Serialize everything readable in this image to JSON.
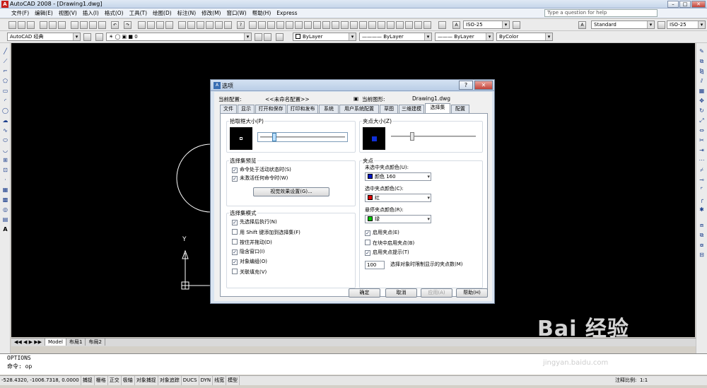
{
  "window": {
    "title": "AutoCAD 2008 - [Drawing1.dwg]",
    "help_placeholder": "Type a question for help"
  },
  "menu": [
    "文件(F)",
    "编辑(E)",
    "视图(V)",
    "插入(I)",
    "格式(O)",
    "工具(T)",
    "绘图(D)",
    "标注(N)",
    "修改(M)",
    "窗口(W)",
    "帮助(H)",
    "Express"
  ],
  "toolbars": {
    "dimstyle": "ISO-25",
    "textstyle": "Standard",
    "tablestyle": "ISO-25",
    "workspace": "AutoCAD 经典",
    "layer": "0",
    "color": "ByLayer",
    "linetype": "ByLayer",
    "lineweight": "ByLayer",
    "plotstyle": "ByColor"
  },
  "canvas": {
    "ucs_y": "Y"
  },
  "layout_tabs": [
    "Model",
    "布局1",
    "布局2"
  ],
  "command": {
    "history": "OPTIONS",
    "prompt": "命令: op"
  },
  "status": {
    "coords": "-528.4320,  -1006.7318,  0.0000",
    "toggles": [
      "捕捉",
      "栅格",
      "正交",
      "极轴",
      "对象捕捉",
      "对象追踪",
      "DUCS",
      "DYN",
      "线宽",
      "模型"
    ],
    "annotation_scale_label": "注释比例:",
    "annotation_scale": "1:1"
  },
  "dialog": {
    "title": "选项",
    "current_profile_label": "当前配置:",
    "current_profile": "<<未命名配置>>",
    "current_drawing_label": "当前图形:",
    "current_drawing": "Drawing1.dwg",
    "tabs": [
      "文件",
      "显示",
      "打开和保存",
      "打印和发布",
      "系统",
      "用户系统配置",
      "草图",
      "三维建模",
      "选择集",
      "配置"
    ],
    "active_tab": "选择集",
    "pickbox_label": "拾取框大小(P)",
    "grip_size_label": "夹点大小(Z)",
    "preview_label": "选择集预览",
    "preview_opt1": "命令处于活动状态时(S)",
    "preview_opt2": "未激活任何命令时(W)",
    "visual_effects_button": "视觉效果设置(G)...",
    "modes_label": "选择集模式",
    "modes": [
      {
        "label": "先选择后执行(N)",
        "checked": true
      },
      {
        "label": "用 Shift 键添加到选择集(F)",
        "checked": false
      },
      {
        "label": "按住并拖动(D)",
        "checked": false
      },
      {
        "label": "隐含窗口(I)",
        "checked": true
      },
      {
        "label": "对象编组(O)",
        "checked": true
      },
      {
        "label": "关联填充(V)",
        "checked": false
      }
    ],
    "grips_label": "夹点",
    "unselected_color_label": "未选中夹点颜色(U):",
    "unselected_color": "颜色 160",
    "selected_color_label": "选中夹点颜色(C):",
    "selected_color": "红",
    "hover_color_label": "悬停夹点颜色(R):",
    "hover_color": "绿",
    "grip_opts": [
      {
        "label": "启用夹点(E)",
        "checked": true
      },
      {
        "label": "在块中启用夹点(B)",
        "checked": false
      },
      {
        "label": "启用夹点提示(T)",
        "checked": true
      }
    ],
    "grip_limit_value": "100",
    "grip_limit_label": "选择对象时限制显示的夹点数(M)",
    "ok": "确定",
    "cancel": "取消",
    "apply": "应用(A)",
    "help": "帮助(H)",
    "colors": {
      "unselected": "#0018c8",
      "selected": "#e00000",
      "hover": "#00c800"
    }
  },
  "watermark": {
    "brand": "Bai 经验",
    "url": "jingyan.baidu.com"
  }
}
